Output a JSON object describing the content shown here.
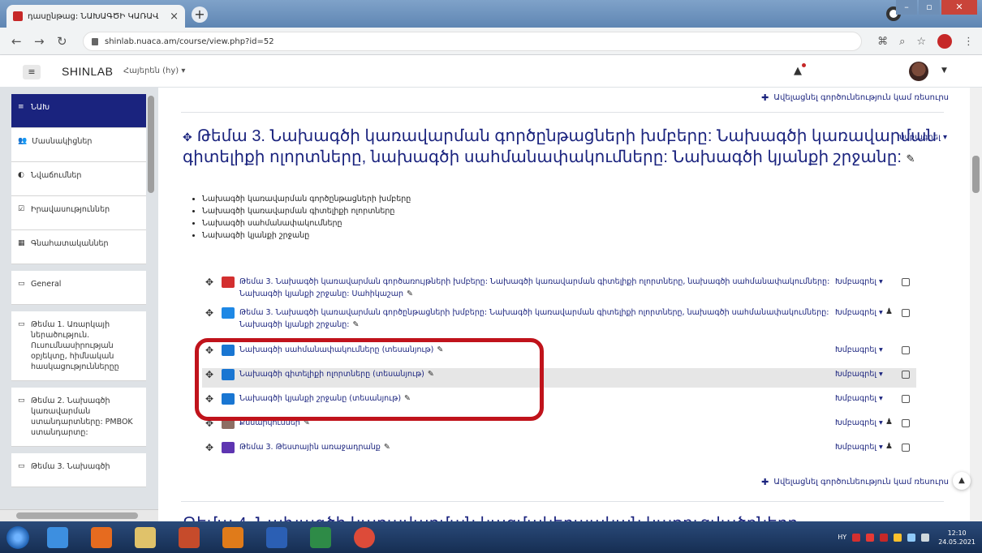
{
  "browser": {
    "tab_title": "դասընթաց: ՆԱԽԱԳԾԻ ԿԱՌԱՎ",
    "tab_close": "×",
    "new_tab": "+",
    "url": "shinlab.nuaca.am/course/view.php?id=52"
  },
  "navbar": {
    "menu_icon": "≡",
    "brand": "SHINLAB",
    "language": "Հայերեն (hy) ▾",
    "bell_icon": "▲"
  },
  "drawer": {
    "items": [
      {
        "icon": "≡",
        "label": "ՆԱԽ"
      },
      {
        "icon": "👥",
        "label": "Մասնակիցներ"
      },
      {
        "icon": "◐",
        "label": "Նվաճումներ"
      },
      {
        "icon": "☑",
        "label": "Իրավասություններ"
      },
      {
        "icon": "▦",
        "label": "Գնահատականներ"
      },
      {
        "icon": "▭",
        "label": "General"
      },
      {
        "icon": "▭",
        "label": "Թեմա 1. Առարկայի ներածություն. Ուսումնասիրության օբյեկտը, հիմնական հասկացություններըը"
      },
      {
        "icon": "▭",
        "label": "Թեմա 2. Նախագծի կառավարման ստանդարտները: PMBOK ստանդարտը:"
      },
      {
        "icon": "▭",
        "label": "Թեմա 3. Նախագծի"
      }
    ]
  },
  "main": {
    "add_activity": "Ավելացնել գործունեություն կամ ռեսուրս",
    "section_title": "Թեմա 3. Նախագծի կառավարման գործընթացների խմբերը: Նախագծի կառավարման գիտելիքի ոլորտները, նախագծի սահմանափակումները: Նախագծի կյանքի շրջանը:",
    "section_edit": "Խմբագրել ▾",
    "summary": [
      "Նախագծի կառավարման գործընթացների խմբերը",
      "Նախագծի կառավարման գիտելիքի ոլորտները",
      "Նախագծի սահմանափակումները",
      "Նախագծի կյանքի շրջանը"
    ],
    "activities": [
      {
        "type": "pdf",
        "name": "Թեմա 3. Նախագծի կառավարման գործառույթների խմբերը: Նախագծի կառավարման գիտելիքի ոլորտները, նախագծի սահմանափակումները: Նախագծի կյանքի շրջանը: Սահիկաշար",
        "edit": "Խմբագրել ▾",
        "user": false
      },
      {
        "type": "files",
        "name": "Թեմա 3. Նախագծի կառավարման գործընթացների խմբերը: Նախագծի կառավարման գիտելիքի ոլորտները, նախագծի սահմանափակումները: Նախագծի կյանքի շրջանը:",
        "edit": "Խմբագրել ▾",
        "user": true
      },
      {
        "type": "doc",
        "name": "Նախագծի սահմանափակումները (տեսանյութ)",
        "edit": "Խմբագրել ▾",
        "user": false
      },
      {
        "type": "doc",
        "name": "Նախագծի գիտելիքի ոլորտները (տեսանյութ)",
        "edit": "Խմբագրել ▾",
        "user": false
      },
      {
        "type": "doc",
        "name": "Նախագծի կյանքի շրջանը (տեսանյութ)",
        "edit": "Խմբագրել ▾",
        "user": false
      },
      {
        "type": "forum",
        "name": "Քննարկումներ",
        "edit": "Խմբագրել ▾",
        "user": true
      },
      {
        "type": "quiz",
        "name": "Թեմա 3. Թեստային առաջադրանք",
        "edit": "Խմբագրել ▾",
        "user": true
      }
    ],
    "next_section": "Թեմա 4. Նախագծի կառավարման կազմակերպական կառուցվածքները"
  },
  "taskbar": {
    "lang": "HY",
    "time": "12:10",
    "date": "24.05.2021"
  },
  "colors": {
    "accent": "#1a237e",
    "annotation": "#c0131b"
  }
}
